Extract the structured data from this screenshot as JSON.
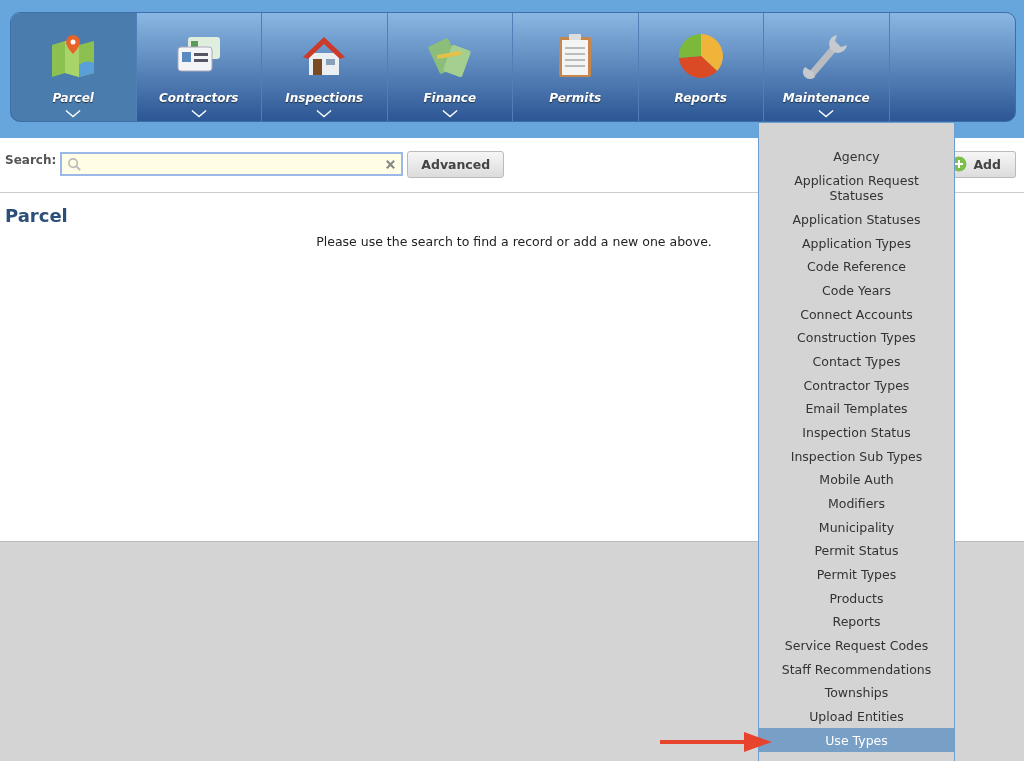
{
  "nav": {
    "tabs": [
      {
        "label": "Parcel",
        "kind": "map",
        "selected": true,
        "dropdown": true
      },
      {
        "label": "Contractors",
        "kind": "cards",
        "selected": false,
        "dropdown": true
      },
      {
        "label": "Inspections",
        "kind": "house",
        "selected": false,
        "dropdown": true
      },
      {
        "label": "Finance",
        "kind": "money",
        "selected": false,
        "dropdown": true
      },
      {
        "label": "Permits",
        "kind": "clipboard",
        "selected": false,
        "dropdown": false
      },
      {
        "label": "Reports",
        "kind": "pie",
        "selected": false,
        "dropdown": false
      },
      {
        "label": "Maintenance",
        "kind": "wrench",
        "selected": false,
        "dropdown": true
      }
    ]
  },
  "search": {
    "label": "Search:",
    "advanced_button": "Advanced",
    "add_button": "Add"
  },
  "page": {
    "title": "Parcel",
    "message": "Please use the search to find a record or add a new one above."
  },
  "maintenance_menu": {
    "items": [
      {
        "label": "Agency",
        "selected": false
      },
      {
        "label": "Application Request Statuses",
        "selected": false
      },
      {
        "label": "Application Statuses",
        "selected": false
      },
      {
        "label": "Application Types",
        "selected": false
      },
      {
        "label": "Code Reference",
        "selected": false
      },
      {
        "label": "Code Years",
        "selected": false
      },
      {
        "label": "Connect Accounts",
        "selected": false
      },
      {
        "label": "Construction Types",
        "selected": false
      },
      {
        "label": "Contact Types",
        "selected": false
      },
      {
        "label": "Contractor Types",
        "selected": false
      },
      {
        "label": "Email Templates",
        "selected": false
      },
      {
        "label": "Inspection Status",
        "selected": false
      },
      {
        "label": "Inspection Sub Types",
        "selected": false
      },
      {
        "label": "Mobile Auth",
        "selected": false
      },
      {
        "label": "Modifiers",
        "selected": false
      },
      {
        "label": "Municipality",
        "selected": false
      },
      {
        "label": "Permit Status",
        "selected": false
      },
      {
        "label": "Permit Types",
        "selected": false
      },
      {
        "label": "Products",
        "selected": false
      },
      {
        "label": "Reports",
        "selected": false
      },
      {
        "label": "Service Request Codes",
        "selected": false
      },
      {
        "label": "Staff Recommendations",
        "selected": false
      },
      {
        "label": "Townships",
        "selected": false
      },
      {
        "label": "Upload Entities",
        "selected": false
      },
      {
        "label": "Use Types",
        "selected": true
      }
    ]
  }
}
